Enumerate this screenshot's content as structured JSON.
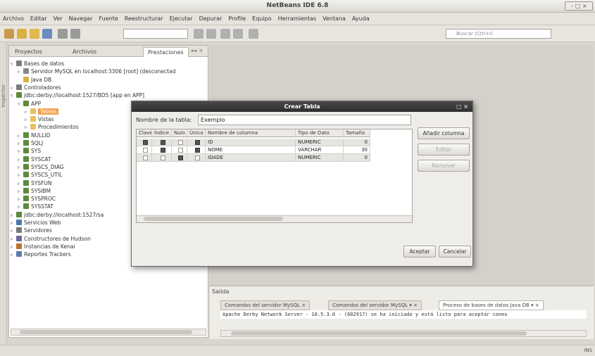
{
  "window": {
    "title": "NetBeans IDE 6.8",
    "controls": "– □ ×"
  },
  "menu": [
    "Archivo",
    "Editar",
    "Ver",
    "Navegar",
    "Fuente",
    "Reestructurar",
    "Ejecutar",
    "Depurar",
    "Profile",
    "Equipo",
    "Herramientas",
    "Ventana",
    "Ayuda"
  ],
  "toolbar": {
    "search_placeholder": "Buscar (Ctrl+I)"
  },
  "left_strip": {
    "label": "Inspector"
  },
  "panel": {
    "tabs": [
      "Proyectos",
      "Archivos",
      "Prestaciones"
    ],
    "close": "◂ ▸ ×",
    "tree": [
      {
        "label": "Bases de datos",
        "depth": 0,
        "toggle": "▿",
        "color": "#7d7d7d"
      },
      {
        "label": "Servidor MySQL en localhost:3306 [root] (desconectad",
        "depth": 1,
        "toggle": "▹",
        "color": "#888"
      },
      {
        "label": "Java DB",
        "depth": 1,
        "toggle": "",
        "color": "#d8b040"
      },
      {
        "label": "Controladores",
        "depth": 0,
        "toggle": "▹",
        "color": "#7d7d7d"
      },
      {
        "label": "jdbc:derby://localhost:1527/BD5 [app en APP]",
        "depth": 0,
        "toggle": "▿",
        "color": "#5a8a3a"
      },
      {
        "label": "APP",
        "depth": 1,
        "toggle": "▿",
        "color": "#5a8a3a"
      },
      {
        "label": "Tablas",
        "depth": 2,
        "toggle": "▹",
        "color": "#e8c060",
        "selected": true
      },
      {
        "label": "Vistas",
        "depth": 2,
        "toggle": "▹",
        "color": "#e8c060"
      },
      {
        "label": "Procedimientos",
        "depth": 2,
        "toggle": "▹",
        "color": "#e8c060"
      },
      {
        "label": "NULLID",
        "depth": 1,
        "toggle": "▹",
        "color": "#5a8a3a"
      },
      {
        "label": "SQLJ",
        "depth": 1,
        "toggle": "▹",
        "color": "#5a8a3a"
      },
      {
        "label": "SYS",
        "depth": 1,
        "toggle": "▹",
        "color": "#5a8a3a"
      },
      {
        "label": "SYSCAT",
        "depth": 1,
        "toggle": "▹",
        "color": "#5a8a3a"
      },
      {
        "label": "SYSCS_DIAG",
        "depth": 1,
        "toggle": "▹",
        "color": "#5a8a3a"
      },
      {
        "label": "SYSCS_UTIL",
        "depth": 1,
        "toggle": "▹",
        "color": "#5a8a3a"
      },
      {
        "label": "SYSFUN",
        "depth": 1,
        "toggle": "▹",
        "color": "#5a8a3a"
      },
      {
        "label": "SYSIBM",
        "depth": 1,
        "toggle": "▹",
        "color": "#5a8a3a"
      },
      {
        "label": "SYSPROC",
        "depth": 1,
        "toggle": "▹",
        "color": "#5a8a3a"
      },
      {
        "label": "SYSSTAT",
        "depth": 1,
        "toggle": "▹",
        "color": "#5a8a3a"
      },
      {
        "label": "jdbc:derby://localhost:1527/sa",
        "depth": 0,
        "toggle": "▹",
        "color": "#5a8a3a"
      },
      {
        "label": "Servicios Web",
        "depth": 0,
        "toggle": "▹",
        "color": "#4a7ab0"
      },
      {
        "label": "Servidores",
        "depth": 0,
        "toggle": "▹",
        "color": "#777"
      },
      {
        "label": "Constructores de Hudson",
        "depth": 0,
        "toggle": "▹",
        "color": "#6a6a9a"
      },
      {
        "label": "Instancias de Kenai",
        "depth": 0,
        "toggle": "▹",
        "color": "#c07030"
      },
      {
        "label": "Reportes Trackers",
        "depth": 0,
        "toggle": "▹",
        "color": "#5a7ab0"
      }
    ]
  },
  "dialog": {
    "title": "Crear Tabla",
    "close": "□ ×",
    "name_label": "Nombre de la tabla:",
    "name_value": "Exemplo",
    "columns": [
      "Clave",
      "Índice",
      "Nulo",
      "Único",
      "Nombre de columna",
      "Tipo de Dato",
      "Tamaño"
    ],
    "rows": [
      {
        "clave": true,
        "indice": true,
        "nulo": false,
        "unico": true,
        "nombre": "ID",
        "tipo": "NUMERIC",
        "tam": "0"
      },
      {
        "clave": false,
        "indice": true,
        "nulo": false,
        "unico": true,
        "nombre": "NOME",
        "tipo": "VARCHAR",
        "tam": "30"
      },
      {
        "clave": false,
        "indice": false,
        "nulo": true,
        "unico": false,
        "nombre": "IDADE",
        "tipo": "NUMERIC",
        "tam": "0"
      }
    ],
    "buttons": {
      "add": "Añadir columna",
      "edit": "Editar",
      "remove": "Remover",
      "accept": "Aceptar",
      "cancel": "Cancelar"
    }
  },
  "output": {
    "label": "Salida",
    "tabs": [
      "Comandos del servidor MySQL ×",
      "Comandos del servidor MySQL ▾ ×",
      "Proceso de bases de datos Java DB ▾ ×"
    ],
    "text": "Apache Derby Network Server - 10.5.3.0 - (802917) se ha iniciado y está listo para aceptar conex"
  },
  "status": {
    "right": "INS"
  }
}
